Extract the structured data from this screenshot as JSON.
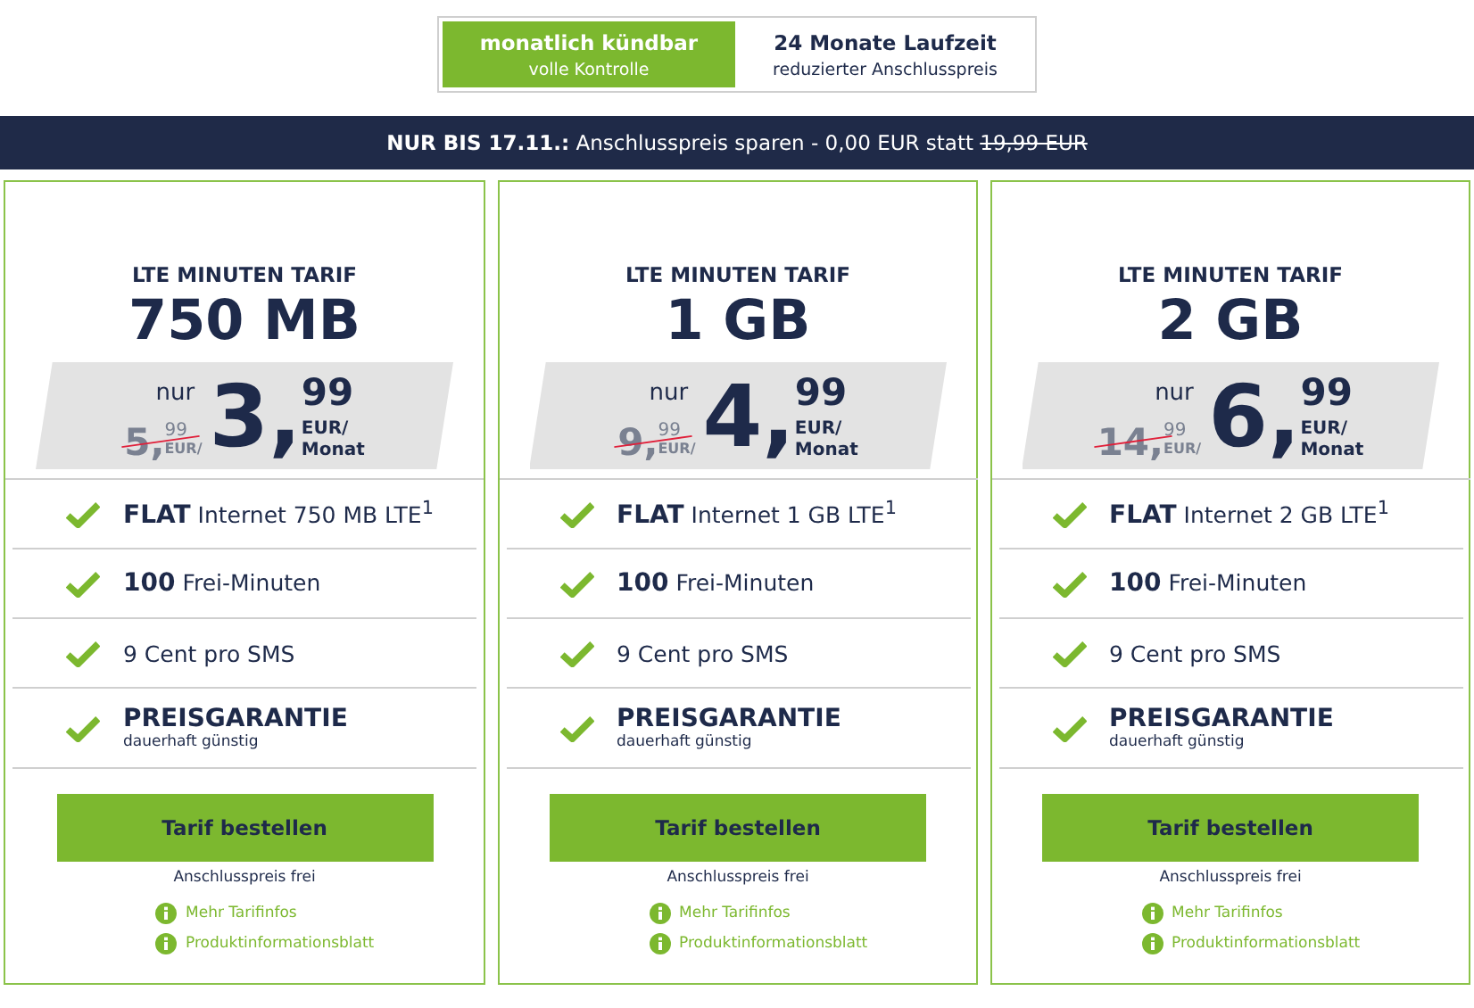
{
  "tabs": [
    {
      "title": "monatlich kündbar",
      "subtitle": "volle Kontrolle",
      "selected": true
    },
    {
      "title": "24 Monate Laufzeit",
      "subtitle": "reduzierter Anschlusspreis",
      "selected": false
    }
  ],
  "banner": {
    "bold": "NUR BIS 17.11.:",
    "text": "Anschlusspreis sparen - 0,00 EUR statt",
    "struck": "19,99 EUR"
  },
  "plans": [
    {
      "kicker": "LTE MINUTEN TARIF",
      "volume": "750 MB",
      "nur": "nur",
      "old_price": {
        "main": "5,",
        "cents": "99",
        "unit": "EUR/"
      },
      "price": {
        "main": "3,",
        "cents": "99",
        "unit": "EUR/",
        "period": "Monat"
      },
      "features": [
        {
          "kind": "text",
          "text": "**FLAT** Internet 750 MB LTE$^{1}$"
        },
        {
          "kind": "text",
          "text": "**100** Frei-Minuten"
        },
        {
          "kind": "text",
          "text": "9 Cent pro SMS"
        },
        {
          "kind": "title",
          "title": "PREISGARANTIE",
          "subtitle": "dauerhaft günstig"
        }
      ],
      "button": "Tarif bestellen",
      "note": "Anschlusspreis frei",
      "links": [
        "Mehr Tarifinfos",
        "Produktinformationsblatt"
      ]
    },
    {
      "kicker": "LTE MINUTEN TARIF",
      "volume": "1 GB",
      "nur": "nur",
      "old_price": {
        "main": "9,",
        "cents": "99",
        "unit": "EUR/"
      },
      "price": {
        "main": "4,",
        "cents": "99",
        "unit": "EUR/",
        "period": "Monat"
      },
      "features": [
        {
          "kind": "text",
          "text": "**FLAT** Internet 1 GB LTE$^{1}$"
        },
        {
          "kind": "text",
          "text": "**100** Frei-Minuten"
        },
        {
          "kind": "text",
          "text": "9 Cent pro SMS"
        },
        {
          "kind": "title",
          "title": "PREISGARANTIE",
          "subtitle": "dauerhaft günstig"
        }
      ],
      "button": "Tarif bestellen",
      "note": "Anschlusspreis frei",
      "links": [
        "Mehr Tarifinfos",
        "Produktinformationsblatt"
      ]
    },
    {
      "kicker": "LTE MINUTEN TARIF",
      "volume": "2 GB",
      "nur": "nur",
      "old_price": {
        "main": "14,",
        "cents": "99",
        "unit": "EUR/"
      },
      "price": {
        "main": "6,",
        "cents": "99",
        "unit": "EUR/",
        "period": "Monat"
      },
      "features": [
        {
          "kind": "text",
          "text": "**FLAT** Internet 2 GB LTE$^{1}$"
        },
        {
          "kind": "text",
          "text": "**100** Frei-Minuten"
        },
        {
          "kind": "text",
          "text": "9 Cent pro SMS"
        },
        {
          "kind": "title",
          "title": "PREISGARANTIE",
          "subtitle": "dauerhaft günstig"
        }
      ],
      "button": "Tarif bestellen",
      "note": "Anschlusspreis frei",
      "links": [
        "Mehr Tarifinfos",
        "Produktinformationsblatt"
      ]
    }
  ]
}
